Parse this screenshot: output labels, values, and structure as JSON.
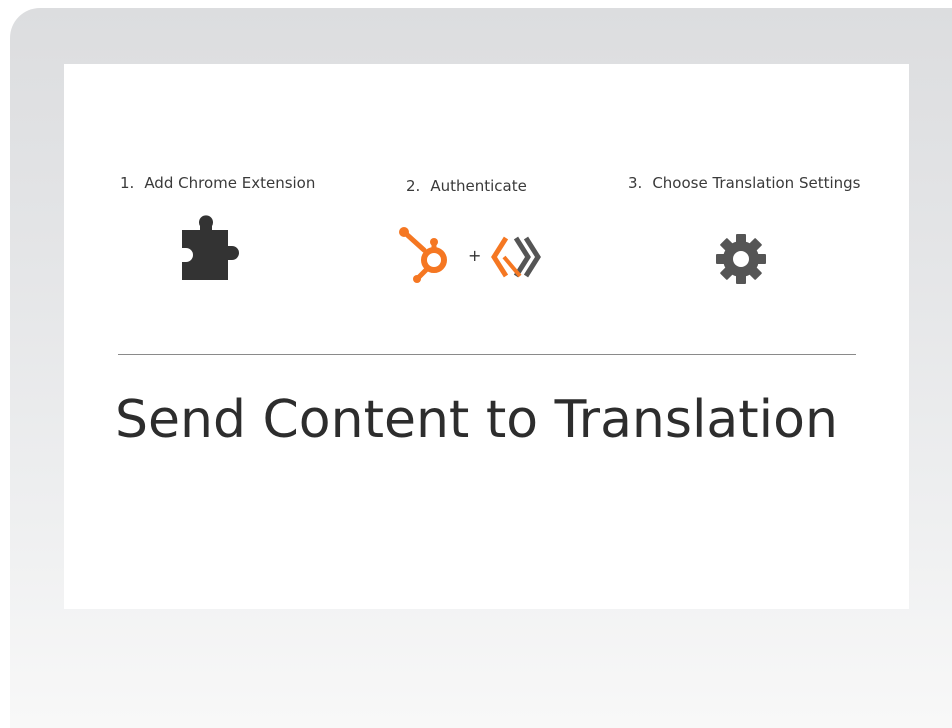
{
  "steps": [
    {
      "number": "1.",
      "label": "Add Chrome Extension",
      "icon": "puzzle-piece-icon"
    },
    {
      "number": "2.",
      "label": "Authenticate",
      "icon": "hubspot-plus-transifex-icon"
    },
    {
      "number": "3.",
      "label": "Choose Translation Settings",
      "icon": "gear-icon"
    }
  ],
  "plus_sign": "+",
  "headline": "Send Content to Translation",
  "colors": {
    "hubspot_orange": "#f57722",
    "dark_gray": "#333333",
    "gear_gray": "#555555"
  }
}
